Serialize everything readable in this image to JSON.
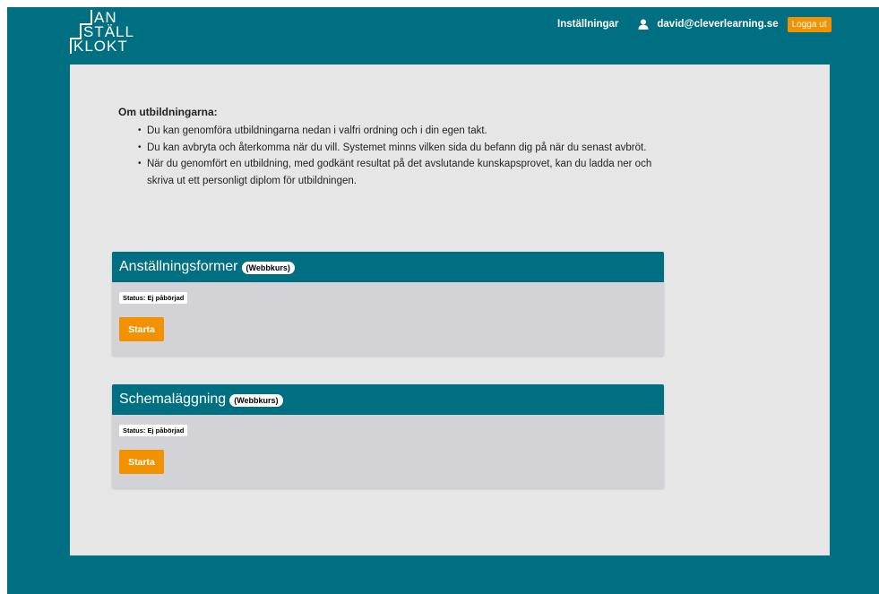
{
  "logo": {
    "line1": "AN",
    "line2": "STÄLL",
    "line3": "KLOKT"
  },
  "nav": {
    "settings_label": "Inställningar",
    "user_email": "david@cleverlearning.se",
    "user_icon": "user-icon",
    "logout_label": "Logga ut"
  },
  "about": {
    "title": "Om utbildningarna:",
    "items": [
      "Du kan genomföra utbildningarna nedan i valfri ordning och i din egen takt.",
      "Du kan avbryta och återkomma när du vill. Systemet minns vilken sida du befann dig på när du senast avbröt.",
      "När du genomfört en utbildning, med godkänt resultat på det avslutande kunskapsprovet, kan du ladda ner och skriva ut ett personligt diplom för utbildningen."
    ]
  },
  "courses": [
    {
      "title": "Anställningsformer",
      "badge": "(Webbkurs)",
      "status": "Status: Ej påbörjad",
      "button": "Starta"
    },
    {
      "title": "Schemaläggning",
      "badge": "(Webbkurs)",
      "status": "Status: Ej påbörjad",
      "button": "Starta"
    }
  ],
  "colors": {
    "brand": "#006f81",
    "accent": "#f39200",
    "panel": "#e6e6e6",
    "card": "#d3d2d6"
  }
}
